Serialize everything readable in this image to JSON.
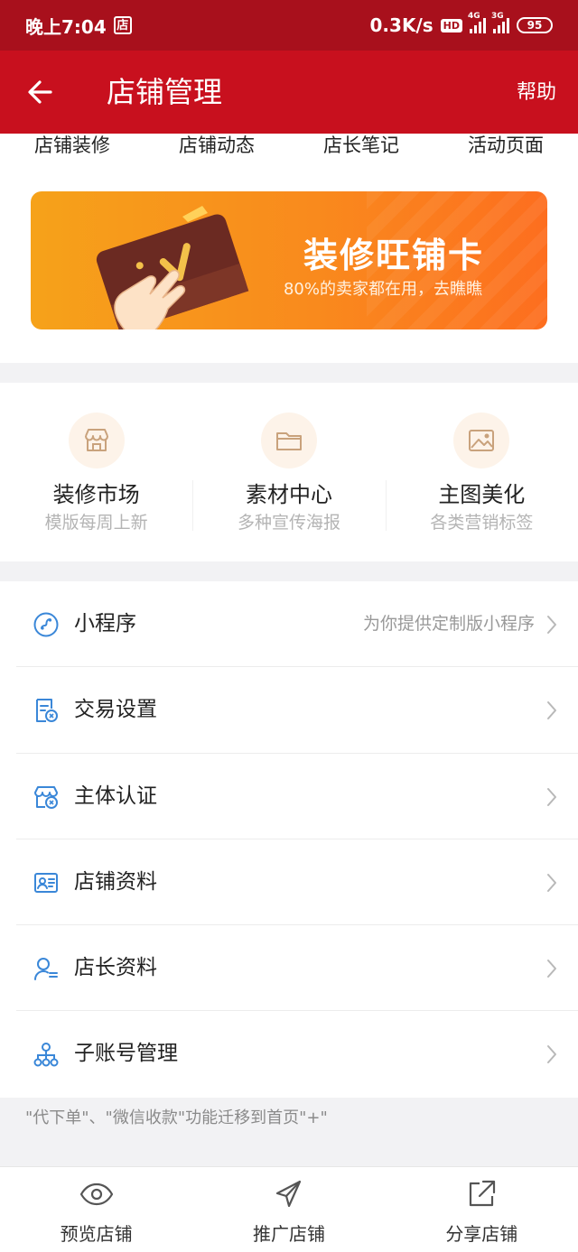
{
  "status_bar": {
    "time": "晚上7:04",
    "shop_badge": "店",
    "network_speed": "0.3K/s",
    "hd": "HD",
    "signal1_label": "4G",
    "signal2_label": "3G",
    "battery": "95"
  },
  "nav": {
    "title": "店铺管理",
    "help": "帮助"
  },
  "top_tabs": [
    "店铺装修",
    "店铺动态",
    "店长笔记",
    "活动页面"
  ],
  "banner": {
    "title": "装修旺铺卡",
    "subtitle": "80%的卖家都在用，去瞧瞧"
  },
  "quick_entries": [
    {
      "title": "装修市场",
      "subtitle": "模版每周上新",
      "icon": "storefront-icon"
    },
    {
      "title": "素材中心",
      "subtitle": "多种宣传海报",
      "icon": "folder-icon"
    },
    {
      "title": "主图美化",
      "subtitle": "各类营销标签",
      "icon": "image-icon"
    }
  ],
  "menu": [
    {
      "label": "小程序",
      "hint": "为你提供定制版小程序",
      "icon": "mini-program-icon"
    },
    {
      "label": "交易设置",
      "hint": "",
      "icon": "trade-settings-icon"
    },
    {
      "label": "主体认证",
      "hint": "",
      "icon": "shop-verify-icon"
    },
    {
      "label": "店铺资料",
      "hint": "",
      "icon": "shop-profile-icon"
    },
    {
      "label": "店长资料",
      "hint": "",
      "icon": "owner-profile-icon"
    },
    {
      "label": "子账号管理",
      "hint": "",
      "icon": "sub-account-icon"
    }
  ],
  "notice": "\"代下单\"、\"微信收款\"功能迁移到首页\"+\"",
  "bottom_tabs": [
    {
      "label": "预览店铺",
      "icon": "eye-icon"
    },
    {
      "label": "推广店铺",
      "icon": "send-icon"
    },
    {
      "label": "分享店铺",
      "icon": "share-icon"
    }
  ],
  "colors": {
    "status_bar": "#a8101c",
    "nav_bar": "#c8101e",
    "banner_gradient_start": "#f6a21a",
    "banner_gradient_end": "#fd6e1f",
    "menu_icon": "#3a87d8",
    "quick_icon": "#c9a27c"
  }
}
